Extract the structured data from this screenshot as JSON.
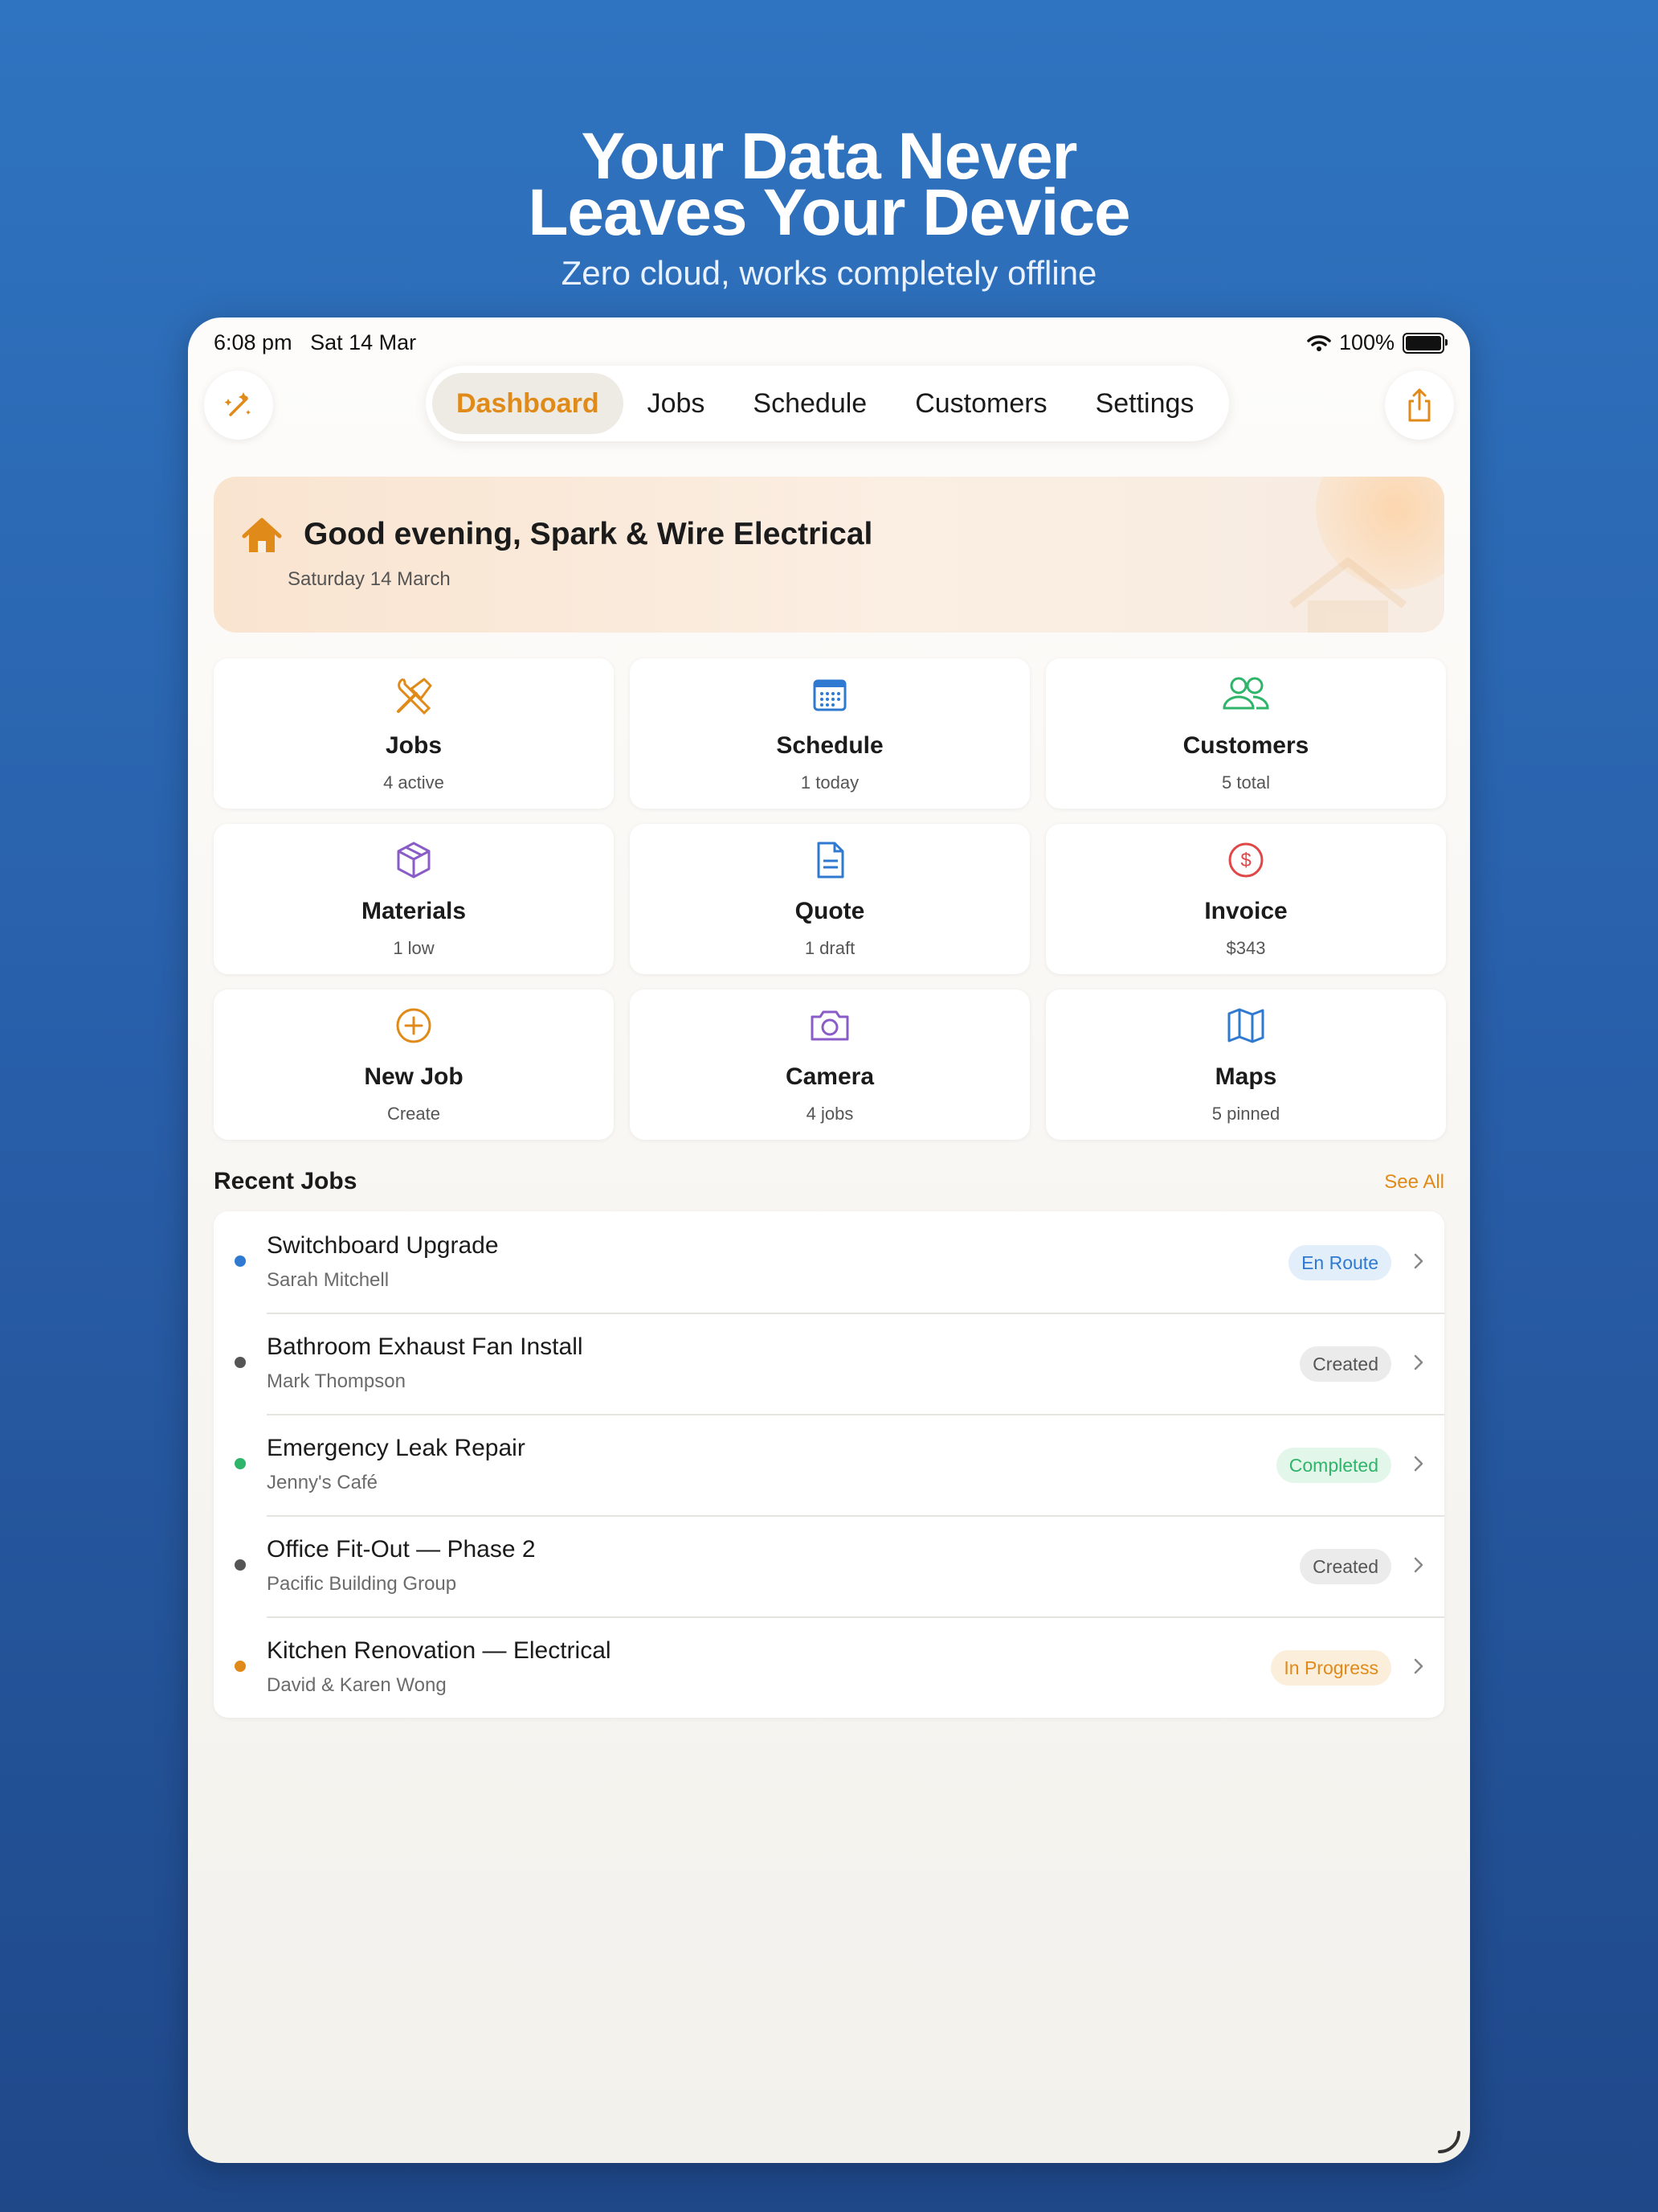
{
  "hero": {
    "title_line1": "Your Data Never",
    "title_line2": "Leaves Your Device",
    "subtitle": "Zero cloud, works completely offline"
  },
  "status_bar": {
    "time": "6:08 pm",
    "date": "Sat 14 Mar",
    "battery": "100%"
  },
  "left_button_icon": "magic-wand-icon",
  "share_button_icon": "share-icon",
  "tabs": [
    {
      "label": "Dashboard",
      "active": true
    },
    {
      "label": "Jobs",
      "active": false
    },
    {
      "label": "Schedule",
      "active": false
    },
    {
      "label": "Customers",
      "active": false
    },
    {
      "label": "Settings",
      "active": false
    }
  ],
  "greeting": {
    "text": "Good evening, Spark & Wire Electrical",
    "date": "Saturday 14 March",
    "icon": "house-icon"
  },
  "tiles": [
    {
      "title": "Jobs",
      "subtitle": "4 active",
      "icon": "tools-icon",
      "color": "#e08a1a"
    },
    {
      "title": "Schedule",
      "subtitle": "1 today",
      "icon": "calendar-icon",
      "color": "#2f7ad0"
    },
    {
      "title": "Customers",
      "subtitle": "5 total",
      "icon": "people-icon",
      "color": "#2fb56a"
    },
    {
      "title": "Materials",
      "subtitle": "1 low",
      "icon": "box-icon",
      "color": "#8a5cc7"
    },
    {
      "title": "Quote",
      "subtitle": "1 draft",
      "icon": "document-icon",
      "color": "#2f7ad0"
    },
    {
      "title": "Invoice",
      "subtitle": "$343",
      "icon": "dollar-icon",
      "color": "#e04848"
    },
    {
      "title": "New Job",
      "subtitle": "Create",
      "icon": "plus-circle-icon",
      "color": "#e08a1a"
    },
    {
      "title": "Camera",
      "subtitle": "4 jobs",
      "icon": "camera-icon",
      "color": "#8a5cc7"
    },
    {
      "title": "Maps",
      "subtitle": "5 pinned",
      "icon": "map-icon",
      "color": "#2f7ad0"
    }
  ],
  "recent_jobs": {
    "header": "Recent Jobs",
    "see_all": "See All",
    "items": [
      {
        "title": "Switchboard Upgrade",
        "customer": "Sarah Mitchell",
        "status": "En Route",
        "dot": "#2f7ad0",
        "badge_bg": "#e3eefb",
        "badge_fg": "#2f7ad0"
      },
      {
        "title": "Bathroom Exhaust Fan Install",
        "customer": "Mark Thompson",
        "status": "Created",
        "dot": "#555555",
        "badge_bg": "#ebebeb",
        "badge_fg": "#555555"
      },
      {
        "title": "Emergency Leak Repair",
        "customer": "Jenny's Café",
        "status": "Completed",
        "dot": "#2fb56a",
        "badge_bg": "#e3f6ea",
        "badge_fg": "#2fb56a"
      },
      {
        "title": "Office Fit-Out — Phase 2",
        "customer": "Pacific Building Group",
        "status": "Created",
        "dot": "#555555",
        "badge_bg": "#ebebeb",
        "badge_fg": "#555555"
      },
      {
        "title": "Kitchen Renovation — Electrical",
        "customer": "David & Karen Wong",
        "status": "In Progress",
        "dot": "#e08a1a",
        "badge_bg": "#fbeedb",
        "badge_fg": "#e08a1a"
      }
    ]
  }
}
